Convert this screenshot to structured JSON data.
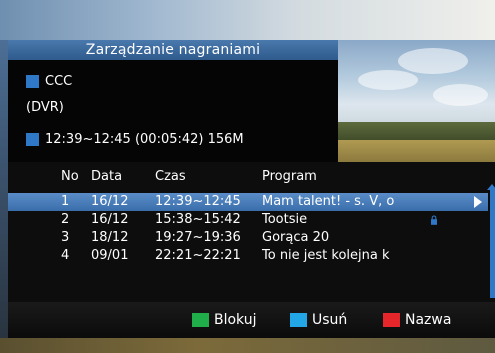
{
  "header": {
    "title": "Zarządzanie nagraniami"
  },
  "info": {
    "channel": "CCC",
    "source": "(DVR)",
    "recording_detail": "12:39~12:45 (00:05:42) 156M"
  },
  "table": {
    "columns": {
      "no": "No",
      "date": "Data",
      "time": "Czas",
      "program": "Program"
    },
    "rows": [
      {
        "no": "1",
        "date": "16/12",
        "time": "12:39~12:45",
        "program": "Mam talent! - s. V, o",
        "selected": true,
        "locked": false
      },
      {
        "no": "2",
        "date": "16/12",
        "time": "15:38~15:42",
        "program": "Tootsie",
        "selected": false,
        "locked": true
      },
      {
        "no": "3",
        "date": "18/12",
        "time": "19:27~19:36",
        "program": "Gorąca 20",
        "selected": false,
        "locked": false
      },
      {
        "no": "4",
        "date": "09/01",
        "time": "22:21~22:21",
        "program": "To nie jest kolejna k",
        "selected": false,
        "locked": false
      }
    ]
  },
  "footer": {
    "green_label": "Blokuj",
    "blue_label": "Usuń",
    "red_label": "Nazwa"
  },
  "colors": {
    "accent_blue": "#2f78c8",
    "selection": "#4a7fbe",
    "key_green": "#1fae4a",
    "key_blue": "#23a6e6",
    "key_red": "#e6262b"
  },
  "icons": {
    "info_bullet": "square-bullet-icon",
    "lock": "lock-icon",
    "selected_marker": "arrow-right-icon"
  }
}
